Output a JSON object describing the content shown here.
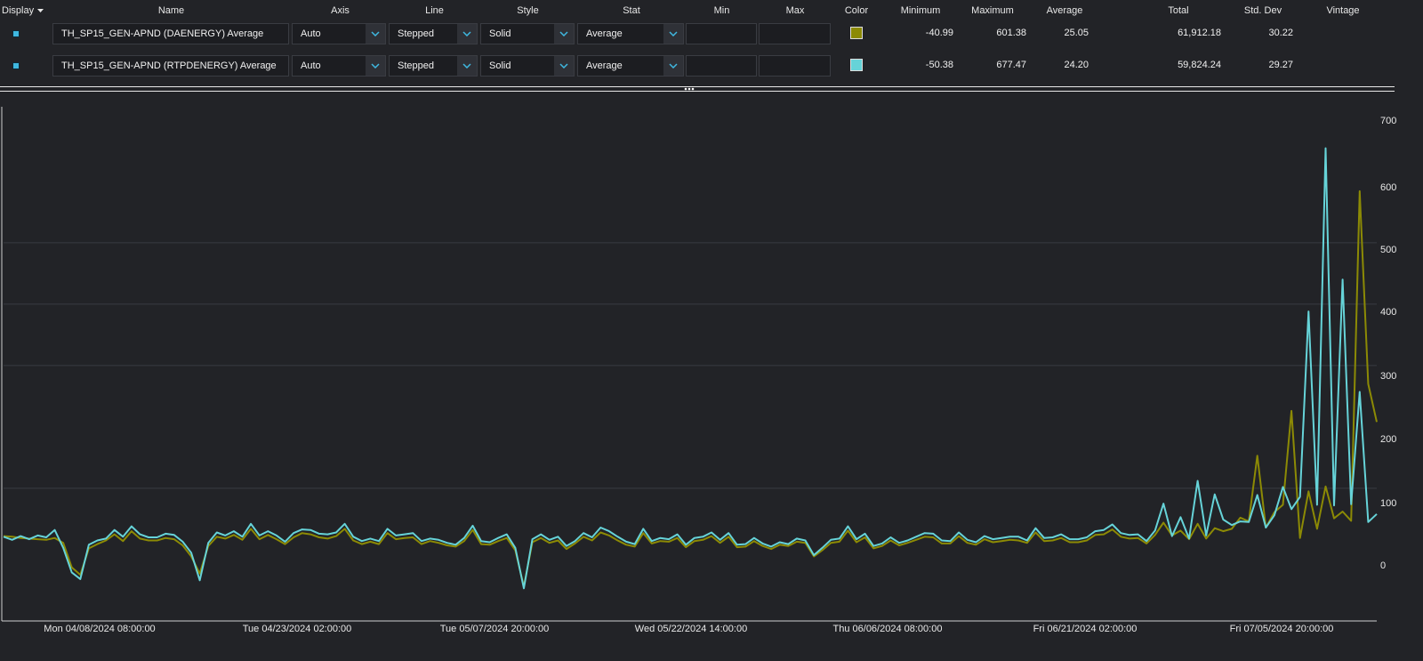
{
  "columns": {
    "display": "Display",
    "name": "Name",
    "axis": "Axis",
    "line": "Line",
    "style": "Style",
    "stat": "Stat",
    "min": "Min",
    "max": "Max",
    "color": "Color",
    "minimum": "Minimum",
    "maximum": "Maximum",
    "average": "Average",
    "total": "Total",
    "std_dev": "Std. Dev",
    "vintage": "Vintage"
  },
  "rows": [
    {
      "name": "TH_SP15_GEN-APND (DAENERGY) Average",
      "axis": "Auto",
      "line": "Stepped",
      "style": "Solid",
      "stat": "Average",
      "min": "",
      "max": "",
      "color": "#8c8a05",
      "minimum": "-40.99",
      "maximum": "601.38",
      "average": "25.05",
      "total": "61,912.18",
      "std_dev": "30.22",
      "vintage": ""
    },
    {
      "name": "TH_SP15_GEN-APND (RTPDENERGY) Average",
      "axis": "Auto",
      "line": "Stepped",
      "style": "Solid",
      "stat": "Average",
      "min": "",
      "max": "",
      "color": "#66d3d8",
      "minimum": "-50.38",
      "maximum": "677.47",
      "average": "24.20",
      "total": "59,824.24",
      "std_dev": "29.27",
      "vintage": ""
    }
  ],
  "icons": {
    "display_sort": "caret-down-icon",
    "dropdown": "chevron-down-icon",
    "display_toggle": "checkbox-icon",
    "splitter": "grip-dots-icon"
  },
  "chart_data": {
    "type": "line",
    "x_ticks": [
      "Mon 04/08/2024 08:00:00",
      "Tue 04/23/2024 02:00:00",
      "Tue 05/07/2024 20:00:00",
      "Wed 05/22/2024 14:00:00",
      "Thu 06/06/2024 08:00:00",
      "Fri 06/21/2024 02:00:00",
      "Fri 07/05/2024 20:00:00"
    ],
    "y_ticks": [
      "700",
      "600",
      "500",
      "400",
      "300",
      "200",
      "100",
      "0"
    ],
    "ylim": [
      -60,
      700
    ],
    "grid": "horizontal",
    "series": [
      {
        "name": "TH_SP15_GEN-APND (DAENERGY) Average",
        "color": "#8c8a05",
        "style": "stepped",
        "y": [
          44,
          43,
          41,
          40,
          39,
          38,
          41,
          33,
          -7,
          -19,
          24,
          31,
          37,
          47,
          36,
          52,
          40,
          37,
          37,
          41,
          39,
          29,
          11,
          -17,
          28,
          43,
          40,
          46,
          38,
          56,
          39,
          46,
          39,
          31,
          42,
          49,
          47,
          42,
          40,
          44,
          56,
          37,
          31,
          35,
          31,
          49,
          39,
          41,
          42,
          31,
          36,
          33,
          29,
          27,
          36,
          54,
          31,
          30,
          36,
          41,
          21,
          -38,
          34,
          41,
          33,
          37,
          23,
          32,
          43,
          37,
          50,
          45,
          37,
          30,
          27,
          49,
          32,
          36,
          35,
          41,
          26,
          36,
          38,
          44,
          33,
          43,
          26,
          27,
          36,
          28,
          23,
          30,
          28,
          35,
          33,
          11,
          21,
          33,
          35,
          53,
          34,
          42,
          24,
          28,
          37,
          29,
          33,
          38,
          43,
          42,
          32,
          32,
          44,
          33,
          30,
          39,
          34,
          36,
          38,
          37,
          33,
          50,
          36,
          37,
          41,
          34,
          34,
          37,
          46,
          47,
          55,
          43,
          40,
          41,
          32,
          46,
          66,
          45,
          53,
          39,
          64,
          40,
          57,
          52,
          56,
          74,
          68,
          175,
          58,
          83,
          95,
          248,
          41,
          117,
          56,
          125,
          73,
          84,
          69,
          606,
          292,
          230
        ]
      },
      {
        "name": "TH_SP15_GEN-APND (RTPDENERGY) Average",
        "color": "#66d3d8",
        "style": "stepped",
        "y": [
          43,
          38,
          44,
          39,
          45,
          42,
          54,
          25,
          -15,
          -26,
          30,
          37,
          40,
          54,
          43,
          60,
          47,
          42,
          42,
          48,
          46,
          35,
          17,
          -28,
          33,
          50,
          45,
          52,
          43,
          64,
          45,
          52,
          45,
          35,
          49,
          55,
          54,
          48,
          47,
          50,
          64,
          43,
          36,
          40,
          36,
          56,
          45,
          47,
          49,
          36,
          40,
          38,
          33,
          30,
          41,
          61,
          36,
          34,
          41,
          47,
          25,
          -41,
          39,
          47,
          38,
          43,
          28,
          36,
          49,
          42,
          58,
          52,
          43,
          35,
          31,
          56,
          36,
          41,
          39,
          47,
          30,
          41,
          43,
          50,
          38,
          49,
          30,
          31,
          41,
          32,
          27,
          34,
          31,
          40,
          37,
          13,
          25,
          38,
          40,
          60,
          39,
          48,
          28,
          32,
          42,
          33,
          37,
          43,
          49,
          48,
          37,
          36,
          50,
          38,
          34,
          44,
          39,
          41,
          43,
          43,
          37,
          57,
          41,
          42,
          47,
          39,
          39,
          42,
          52,
          54,
          63,
          49,
          46,
          47,
          36,
          53,
          97,
          44,
          75,
          40,
          134,
          45,
          112,
          71,
          62,
          68,
          67,
          111,
          58,
          78,
          124,
          88,
          108,
          410,
          95,
          676,
          94,
          462,
          96,
          279,
          67,
          80
        ]
      }
    ]
  }
}
